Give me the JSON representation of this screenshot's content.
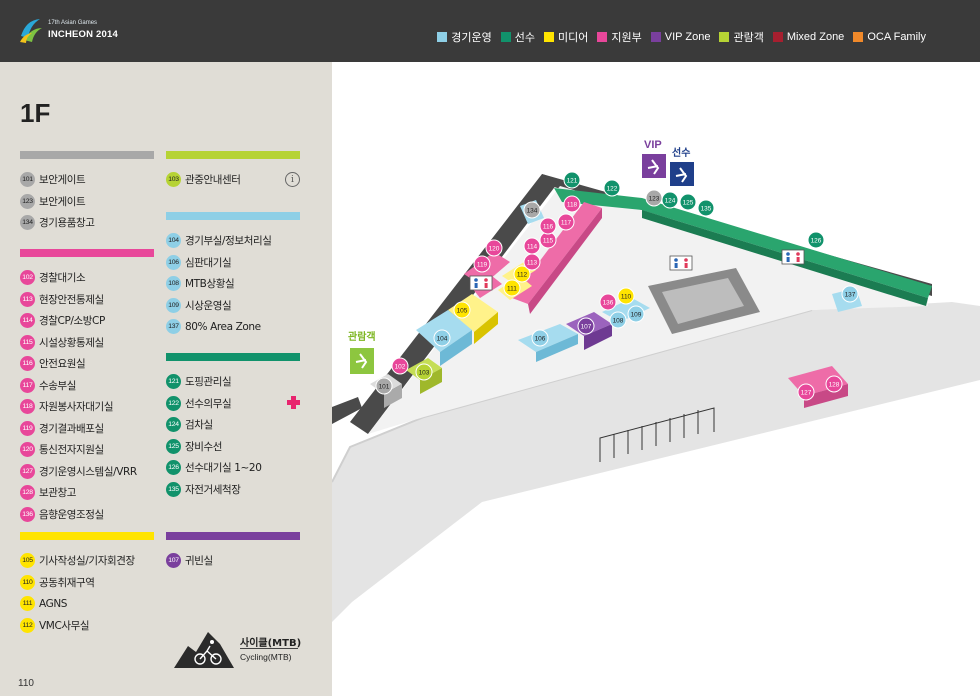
{
  "header": {
    "logo_sub": "17th Asian Games",
    "logo_main": "INCHEON 2014",
    "legend": [
      {
        "label": "경기운영",
        "color": "#8ecfe6"
      },
      {
        "label": "선수",
        "color": "#11926b"
      },
      {
        "label": "미디어",
        "color": "#ffe400"
      },
      {
        "label": "지원부",
        "color": "#e8479a"
      },
      {
        "label": "VIP Zone",
        "color": "#7a3f9d"
      },
      {
        "label": "관람객",
        "color": "#b6d334"
      },
      {
        "label": "Mixed Zone",
        "color": "#a61f2f"
      },
      {
        "label": "OCA Family",
        "color": "#f0892a"
      }
    ]
  },
  "sidebar": {
    "floor": "1F",
    "groups": {
      "security": {
        "color": "#a8a8a8",
        "items": [
          {
            "num": "101",
            "label": "보안게이트"
          },
          {
            "num": "123",
            "label": "보안게이트"
          },
          {
            "num": "134",
            "label": "경기용품창고"
          }
        ]
      },
      "spectator": {
        "color": "#b6d334",
        "items": [
          {
            "num": "103",
            "label": "관중안내센터"
          }
        ]
      },
      "operations": {
        "color": "#8ecfe6",
        "items": [
          {
            "num": "104",
            "label": "경기부실/정보처리실"
          },
          {
            "num": "106",
            "label": "심판대기실"
          },
          {
            "num": "108",
            "label": "MTB상황실"
          },
          {
            "num": "109",
            "label": "시상운영실"
          },
          {
            "num": "137",
            "label": "80% Area Zone"
          }
        ]
      },
      "support": {
        "color": "#e8479a",
        "items": [
          {
            "num": "102",
            "label": "경찰대기소"
          },
          {
            "num": "113",
            "label": "현장안전통제실"
          },
          {
            "num": "114",
            "label": "경찰CP/소방CP"
          },
          {
            "num": "115",
            "label": "시설상황통제실"
          },
          {
            "num": "116",
            "label": "안전요원실"
          },
          {
            "num": "117",
            "label": "수송부실"
          },
          {
            "num": "118",
            "label": "자원봉사자대기실"
          },
          {
            "num": "119",
            "label": "경기결과배포실"
          },
          {
            "num": "120",
            "label": "통신전자지원실"
          },
          {
            "num": "127",
            "label": "경기운영시스템실/VRR"
          },
          {
            "num": "128",
            "label": "보관창고"
          },
          {
            "num": "136",
            "label": "음향운영조정실"
          }
        ]
      },
      "athlete": {
        "color": "#11926b",
        "items": [
          {
            "num": "121",
            "label": "도핑관리실"
          },
          {
            "num": "122",
            "label": "선수의무실"
          },
          {
            "num": "124",
            "label": "검차실"
          },
          {
            "num": "125",
            "label": "장비수선"
          },
          {
            "num": "126",
            "label": "선수대기실 1~20"
          },
          {
            "num": "135",
            "label": "자전거세척장"
          }
        ]
      },
      "media": {
        "color": "#ffe400",
        "items": [
          {
            "num": "105",
            "label": "기사작성실/기자회견장"
          },
          {
            "num": "110",
            "label": "공동취재구역"
          },
          {
            "num": "111",
            "label": "AGNS"
          },
          {
            "num": "112",
            "label": "VMC사무실"
          }
        ]
      },
      "vip": {
        "color": "#7a3f9d",
        "items": [
          {
            "num": "107",
            "label": "귀빈실"
          }
        ]
      }
    },
    "venue": {
      "ko": "사이클(MTB)",
      "en": "Cycling(MTB)"
    },
    "page_number": "110"
  },
  "map": {
    "labels": {
      "vip": "VIP",
      "athlete": "선수",
      "spectator": "관람객"
    }
  }
}
